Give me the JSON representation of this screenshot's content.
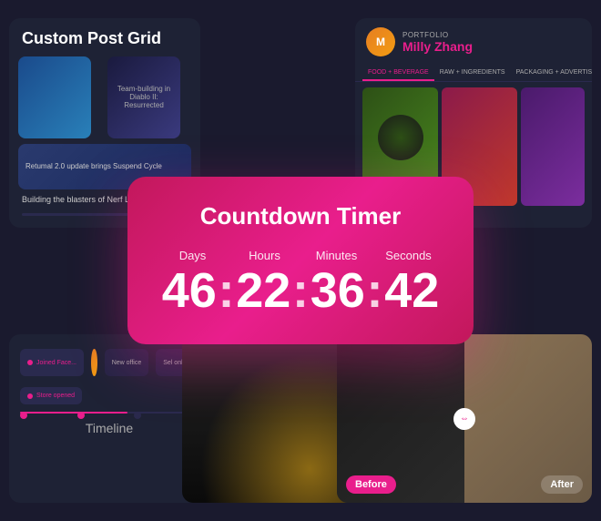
{
  "cards": {
    "post_grid": {
      "title": "Custom\nPost Grid",
      "items": [
        {
          "caption": "Building the blasters of Nerf Legends"
        },
        {
          "caption": "Retumal 2.0 update brings Suspend Cycle"
        },
        {
          "caption": "Team-building in Diablo II: Resurrected"
        }
      ]
    },
    "portfolio": {
      "label": "PORTFOLIO",
      "name": "Milly Zhang",
      "tabs": [
        {
          "label": "FOOD + BEVERAGE",
          "active": true
        },
        {
          "label": "RAW + INGREDIENTS",
          "active": false
        },
        {
          "label": "PACKAGING + ADVERTISING",
          "active": false
        }
      ]
    },
    "timeline": {
      "label": "Timeline",
      "items": [
        {
          "text": "Joined Face..."
        },
        {
          "text": "Store opened"
        },
        {
          "text": "New office"
        },
        {
          "text": "Sel online"
        }
      ]
    },
    "before_after": {
      "before_label": "Before",
      "after_label": "After"
    }
  },
  "countdown": {
    "title": "Countdown Timer",
    "labels": {
      "days": "Days",
      "hours": "Hours",
      "minutes": "Minutes",
      "seconds": "Seconds"
    },
    "values": {
      "days": "46",
      "hours": "22",
      "minutes": "36",
      "seconds": "42"
    },
    "separator": ":"
  },
  "colors": {
    "accent": "#e91e8c",
    "bg_dark": "#1e2235",
    "text_light": "#ffffff"
  }
}
